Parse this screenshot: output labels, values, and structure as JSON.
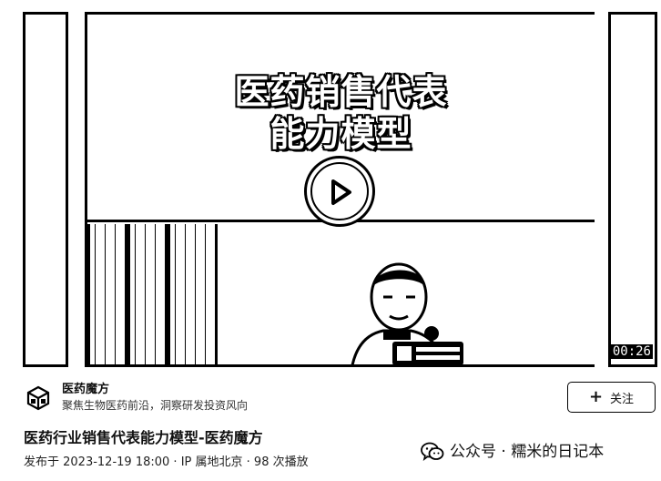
{
  "video": {
    "title_line1": "医药销售代表",
    "title_line2": "能力模型",
    "duration": "00:26"
  },
  "account": {
    "name": "医药魔方",
    "description": "聚焦生物医药前沿，洞察研发投资风向",
    "follow_label": "关注",
    "follow_icon": "plus-icon"
  },
  "article": {
    "title": "医药行业销售代表能力模型-医药魔方"
  },
  "meta": {
    "published_prefix": "发布于 ",
    "date": "2023-12-19 18:00",
    "sep1": " · ",
    "location": "IP 属地北京",
    "sep2": " · ",
    "plays": "98 次播放"
  },
  "watermark": {
    "text": "公众号 · 糯米的日记本",
    "icon": "wechat-icon"
  },
  "colors": {
    "foreground": "#000000",
    "background": "#ffffff"
  }
}
